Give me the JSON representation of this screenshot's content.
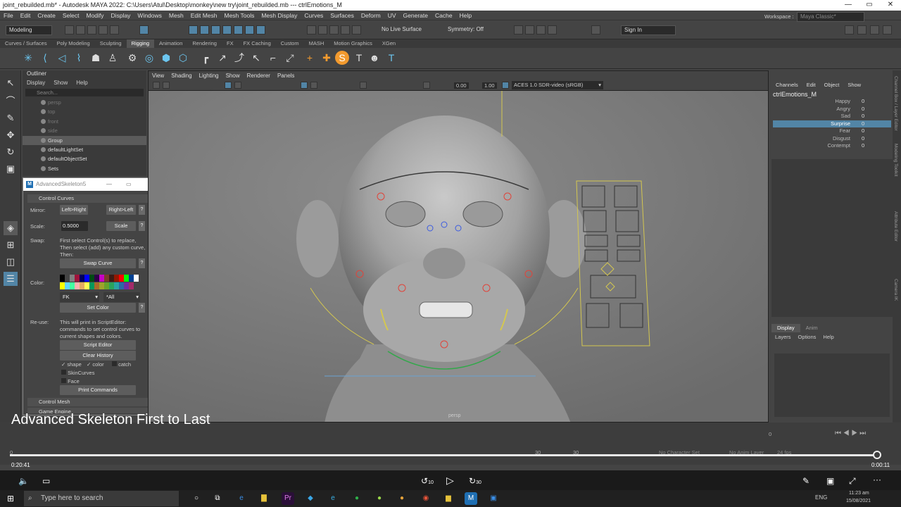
{
  "title_bar": {
    "text": "joint_rebuilded.mb* - Autodesk MAYA 2022: C:\\Users\\Atul\\Desktop\\monkey\\new try\\joint_rebuilded.mb   ---   ctrlEmotions_M"
  },
  "menu": [
    "File",
    "Edit",
    "Create",
    "Select",
    "Modify",
    "Display",
    "Windows",
    "Mesh",
    "Edit Mesh",
    "Mesh Tools",
    "Mesh Display",
    "Curves",
    "Surfaces",
    "Deform",
    "UV",
    "Generate",
    "Cache",
    "Help"
  ],
  "status_line": {
    "mode": "Modeling",
    "live_surface": "No Live Surface",
    "symmetry": "Symmetry: Off",
    "sign_in": "Sign In",
    "workspace_label": "Workspace :",
    "workspace_value": "Maya Classic*"
  },
  "shelf_tabs": [
    "Curves / Surfaces",
    "Poly Modeling",
    "Sculpting",
    "Rigging",
    "Animation",
    "Rendering",
    "FX",
    "FX Caching",
    "Custom",
    "MASH",
    "Motion Graphics",
    "XGen"
  ],
  "shelf_active": "Rigging",
  "outliner": {
    "title": "Outliner",
    "menu": [
      "Display",
      "Show",
      "Help"
    ],
    "search_placeholder": "Search...",
    "items": [
      {
        "label": "persp",
        "dim": true
      },
      {
        "label": "top",
        "dim": true
      },
      {
        "label": "front",
        "dim": true
      },
      {
        "label": "side",
        "dim": true
      },
      {
        "label": "Group",
        "dim": false,
        "selected": true
      },
      {
        "label": "defaultLightSet",
        "dim": false
      },
      {
        "label": "defaultObjectSet",
        "dim": false
      },
      {
        "label": "Sets",
        "dim": false
      }
    ]
  },
  "advanced_skeleton": {
    "window_title": "AdvancedSkeleton5",
    "section_control_curves": "Control Curves",
    "mirror_label": "Mirror:",
    "mirror_btn1": "Left>Right",
    "mirror_btn2": "Right>Left",
    "help": "?",
    "scale_label": "Scale:",
    "scale_value": "0.5000",
    "scale_btn": "Scale",
    "swap_label": "Swap:",
    "swap_text1": "First select Control(s) to replace,",
    "swap_text2": "Then select (add) any custom curve,",
    "swap_text3": "Then:",
    "swap_btn": "Swap Curve",
    "color_label": "Color:",
    "palette": [
      "#000000",
      "#444444",
      "#7f7f7f",
      "#a0133a",
      "#00005b",
      "#0000ff",
      "#004a15",
      "#2e0047",
      "#c700c7",
      "#7a3d2b",
      "#3d1c14",
      "#941700",
      "#ff0000",
      "#00ff00",
      "#004094",
      "#ffffff",
      "#ffff00",
      "#62d6ff",
      "#43ffa2",
      "#ffb0b0",
      "#e3ab62",
      "#ffff55",
      "#00995c",
      "#a96a2b",
      "#9ea32b",
      "#68a32b",
      "#2ba35c",
      "#2ba3a3",
      "#2b69a3",
      "#712ba3",
      "#a32b69"
    ],
    "fk_option": "FK",
    "all_option": "*All",
    "set_color_btn": "Set Color",
    "reuse_label": "Re-use:",
    "reuse_text1": "This will print in ScriptEditor:",
    "reuse_text2": "commands to set control curves to",
    "reuse_text3": "current shapes and colors.",
    "script_editor_btn": "Script Editor",
    "clear_history_btn": "Clear History",
    "cb_shape": "shape",
    "cb_color": "color",
    "cb_catch": "catch",
    "cb_skincurves": "SkinCurves",
    "cb_face": "Face",
    "print_commands_btn": "Print Commands",
    "section_control_mesh": "Control Mesh",
    "section_game_engine": "Game Engine"
  },
  "viewport": {
    "menu": [
      "View",
      "Shading",
      "Lighting",
      "Show",
      "Renderer",
      "Panels"
    ],
    "val1": "0.00",
    "val2": "1.00",
    "colorspace": "ACES 1.0 SDR-video (sRGB)",
    "camera_label": "persp"
  },
  "channel_box": {
    "menu": [
      "Channels",
      "Edit",
      "Object",
      "Show"
    ],
    "object": "ctrlEmotions_M",
    "channels": [
      {
        "name": "Happy",
        "value": "0"
      },
      {
        "name": "Angry",
        "value": "0"
      },
      {
        "name": "Sad",
        "value": "0"
      },
      {
        "name": "Surprise",
        "value": "0",
        "selected": true
      },
      {
        "name": "Fear",
        "value": "0"
      },
      {
        "name": "Disgust",
        "value": "0"
      },
      {
        "name": "Contempt",
        "value": "0"
      }
    ],
    "side_tabs": [
      "Channel Box / Layer Editor",
      "Modeling Toolkit",
      "Attribute Editor",
      "Camera IK"
    ]
  },
  "layer_editor": {
    "tabs": [
      "Display",
      "Anim"
    ],
    "menu": [
      "Layers",
      "Options",
      "Help"
    ]
  },
  "timeline": {
    "start": "0",
    "end": "30",
    "end2": "30",
    "no_char_set": "No Character Set",
    "no_anim_layer": "No Anim Layer",
    "fps": "24 fps"
  },
  "video": {
    "overlay_title": "Advanced Skeleton First to Last",
    "elapsed": "0:20:41",
    "remaining": "0:00:11",
    "progress": 0.995,
    "skip_back": "10",
    "skip_fwd": "30"
  },
  "taskbar": {
    "search_placeholder": "Type here to search",
    "lang": "ENG",
    "time": "11:23 am",
    "date": "15/08/2021"
  }
}
